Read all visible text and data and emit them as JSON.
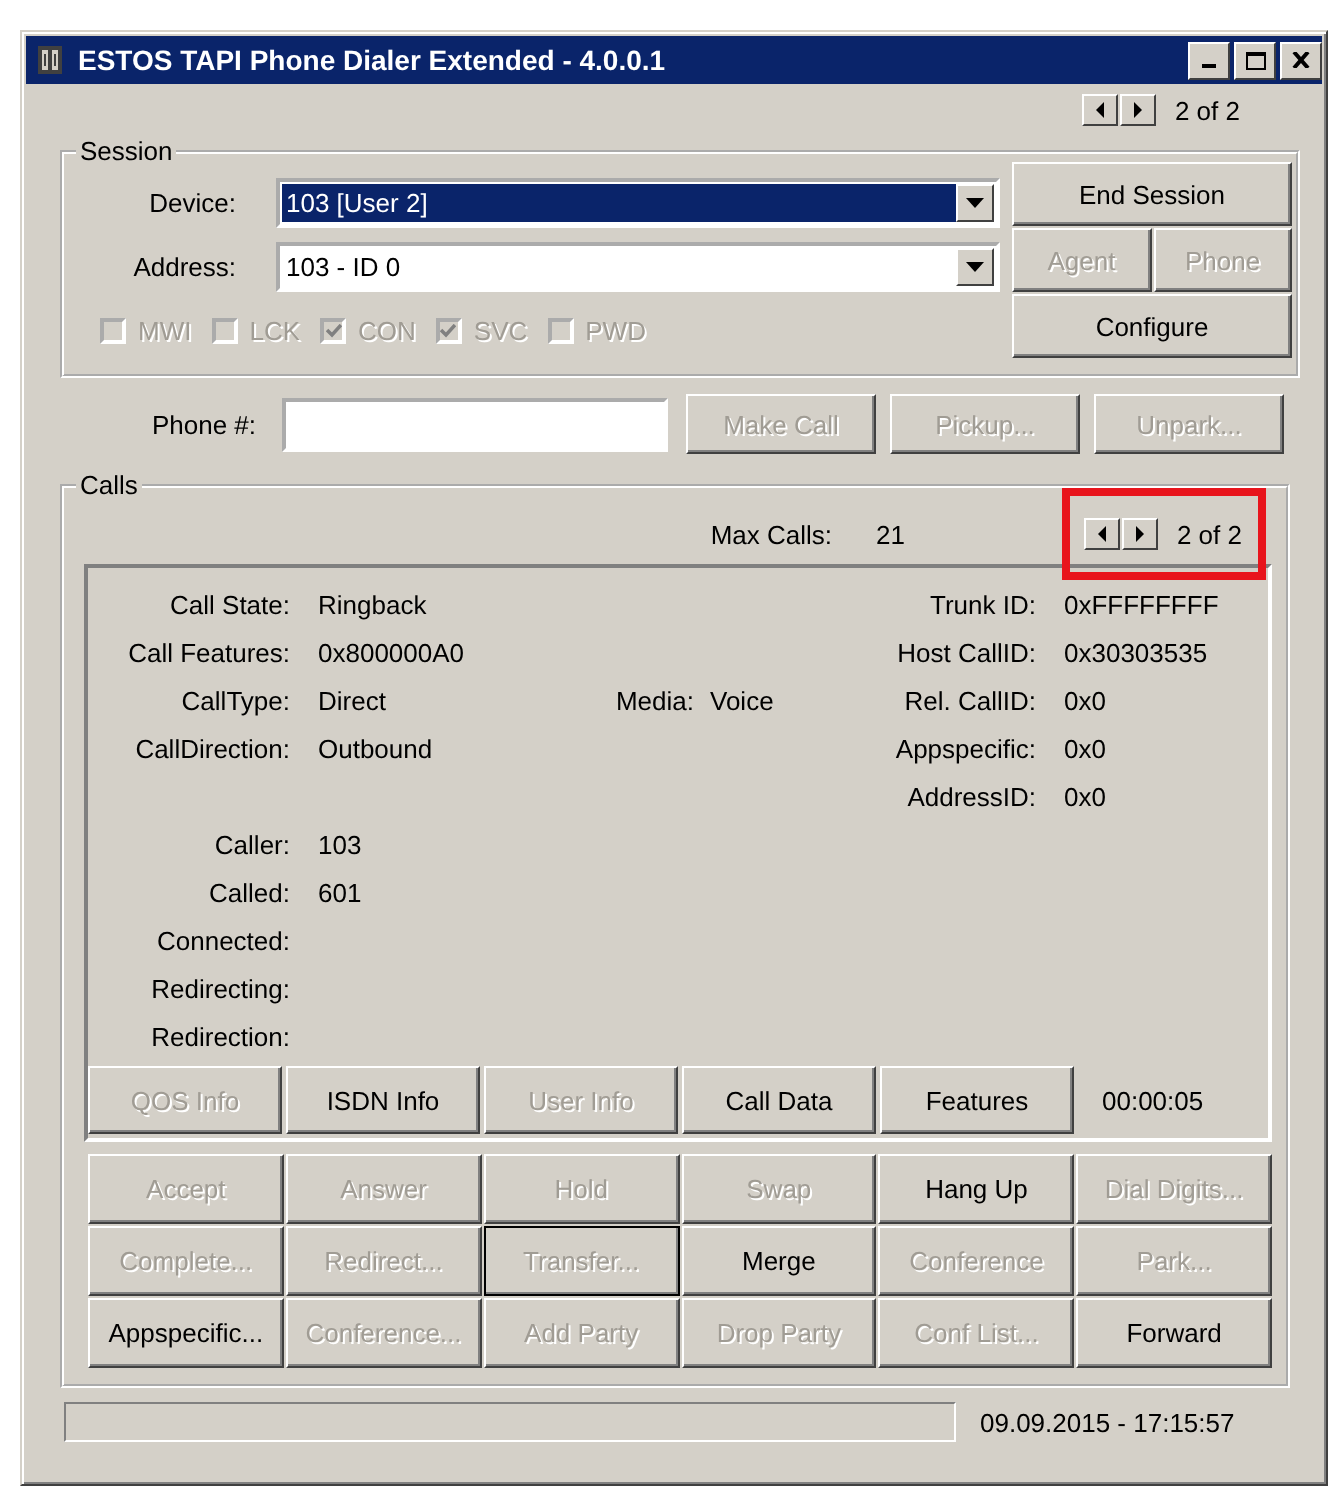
{
  "window": {
    "title": "ESTOS TAPI Phone Dialer Extended - 4.0.0.1"
  },
  "session_nav": {
    "position": "2 of 2"
  },
  "session": {
    "title": "Session",
    "fields": [
      {
        "label": "Device:",
        "value": "103 [User 2]",
        "selected": true
      },
      {
        "label": "Address:",
        "value": "103 - ID 0",
        "selected": false
      }
    ],
    "buttons": [
      [
        {
          "label": "End Session",
          "disabled": false
        }
      ],
      [
        {
          "label": "Agent",
          "disabled": true
        },
        {
          "label": "Phone",
          "disabled": true
        }
      ],
      [
        {
          "label": "Configure",
          "disabled": false
        }
      ]
    ],
    "flags": [
      {
        "label": "MWI",
        "checked": false,
        "disabled": true
      },
      {
        "label": "LCK",
        "checked": false,
        "disabled": true
      },
      {
        "label": "CON",
        "checked": true,
        "disabled": true
      },
      {
        "label": "SVC",
        "checked": true,
        "disabled": true
      },
      {
        "label": "PWD",
        "checked": false,
        "disabled": true
      }
    ]
  },
  "phone": {
    "label": "Phone #:",
    "buttons": [
      {
        "label": "Make Call",
        "disabled": true
      },
      {
        "label": "Pickup...",
        "disabled": true
      },
      {
        "label": "Unpark...",
        "disabled": true
      }
    ]
  },
  "calls": {
    "title": "Calls",
    "max_calls_label": "Max Calls:",
    "max_calls": "21",
    "nav": {
      "position": "2 of 2",
      "highlighted": true
    },
    "details_left": [
      {
        "label": "Call State:",
        "value": "Ringback"
      },
      {
        "label": "Call Features:",
        "value": "0x800000A0"
      },
      {
        "label": "CallType:",
        "value": "Direct"
      },
      {
        "label": "CallDirection:",
        "value": "Outbound"
      }
    ],
    "media": {
      "label": "Media:",
      "value": "Voice"
    },
    "details_right": [
      {
        "label": "Trunk ID:",
        "value": "0xFFFFFFFF"
      },
      {
        "label": "Host CallID:",
        "value": "0x30303535"
      },
      {
        "label": "Rel. CallID:",
        "value": "0x0"
      },
      {
        "label": "Appspecific:",
        "value": "0x0"
      },
      {
        "label": "AddressID:",
        "value": "0x0"
      }
    ],
    "parties": [
      {
        "label": "Caller:",
        "value": "103"
      },
      {
        "label": "Called:",
        "value": "601"
      },
      {
        "label": "Connected:"
      },
      {
        "label": "Redirecting:"
      },
      {
        "label": "Redirection:"
      }
    ],
    "info_buttons": [
      {
        "label": "QOS Info",
        "disabled": true
      },
      {
        "label": "ISDN Info",
        "disabled": false
      },
      {
        "label": "User Info",
        "disabled": true
      },
      {
        "label": "Call Data",
        "disabled": false
      },
      {
        "label": "Features",
        "disabled": false
      }
    ],
    "duration": "00:00:05",
    "actions": [
      [
        {
          "label": "Accept",
          "disabled": true,
          "focused": false
        },
        {
          "label": "Answer",
          "disabled": true,
          "focused": false
        },
        {
          "label": "Hold",
          "disabled": true,
          "focused": false
        },
        {
          "label": "Swap",
          "disabled": true,
          "focused": false
        },
        {
          "label": "Hang Up",
          "disabled": false,
          "focused": false
        },
        {
          "label": "Dial Digits...",
          "disabled": true,
          "focused": false
        }
      ],
      [
        {
          "label": "Complete...",
          "disabled": true,
          "focused": false
        },
        {
          "label": "Redirect...",
          "disabled": true,
          "focused": false
        },
        {
          "label": "Transfer...",
          "disabled": true,
          "focused": true
        },
        {
          "label": "Merge",
          "disabled": false,
          "focused": false
        },
        {
          "label": "Conference",
          "disabled": true,
          "focused": false
        },
        {
          "label": "Park...",
          "disabled": true,
          "focused": false
        }
      ],
      [
        {
          "label": "Appspecific...",
          "disabled": false,
          "focused": false
        },
        {
          "label": "Conference...",
          "disabled": true,
          "focused": false
        },
        {
          "label": "Add Party",
          "disabled": true,
          "focused": false
        },
        {
          "label": "Drop Party",
          "disabled": true,
          "focused": false
        },
        {
          "label": "Conf List...",
          "disabled": true,
          "focused": false
        },
        {
          "label": "Forward",
          "disabled": false,
          "focused": false
        }
      ]
    ]
  },
  "status_bar": {
    "datetime": "09.09.2015 - 17:15:57"
  }
}
